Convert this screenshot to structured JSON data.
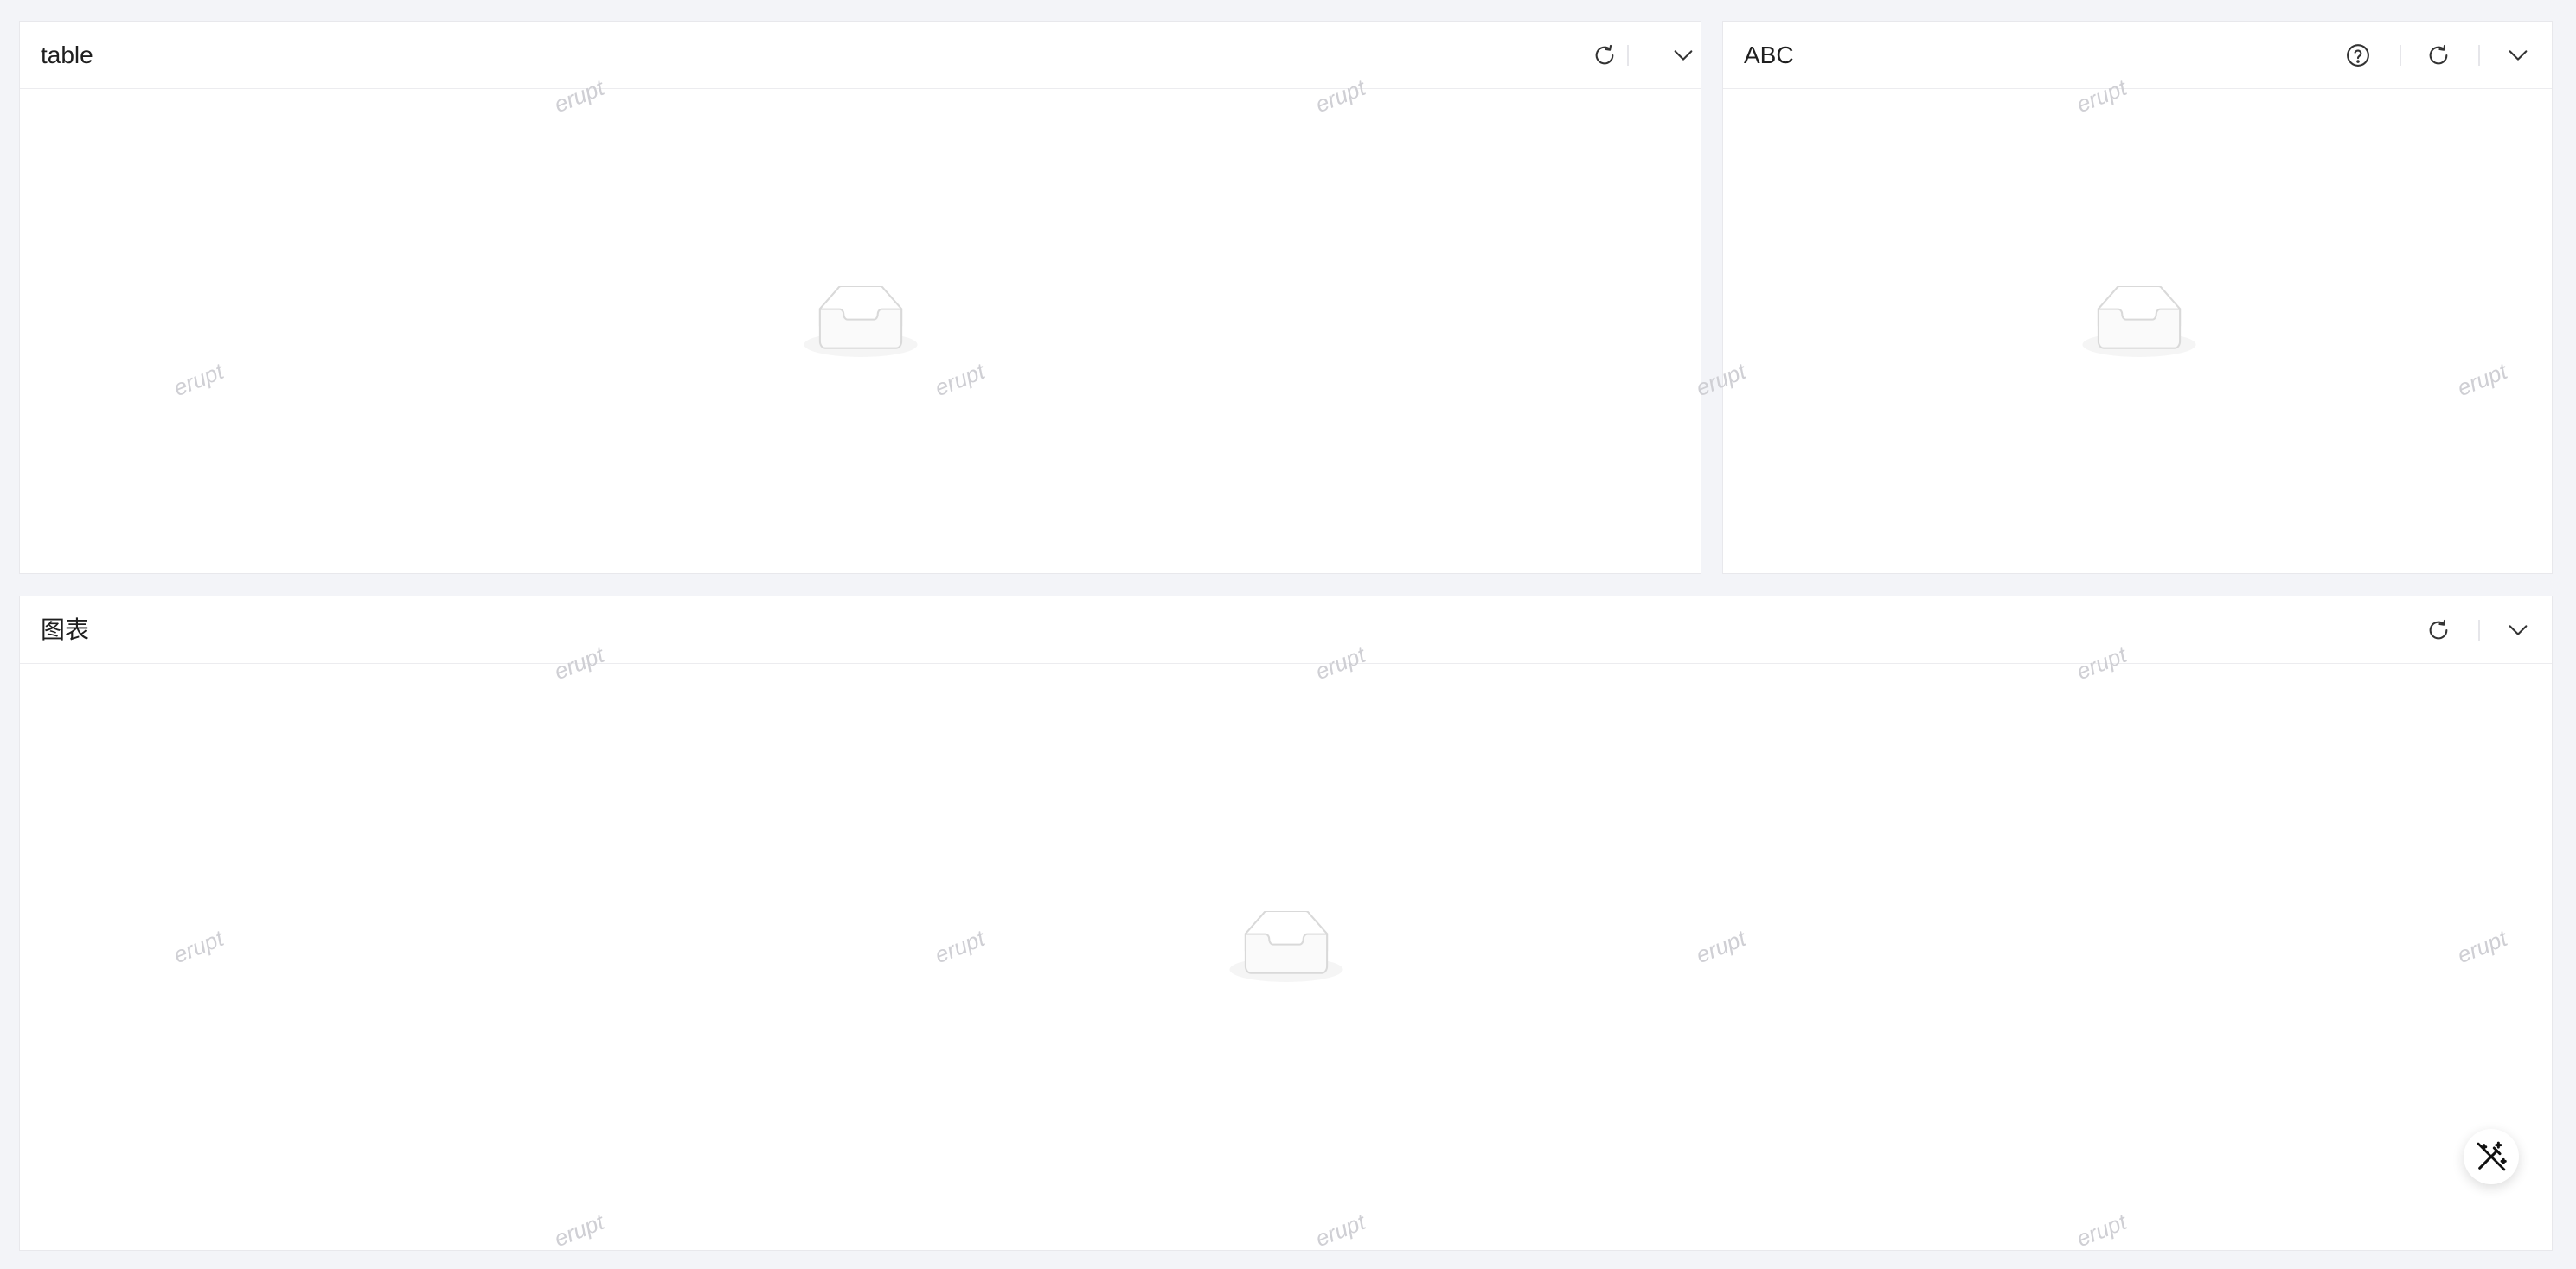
{
  "watermark_text": "erupt",
  "panels": [
    {
      "title": "table",
      "icons": [
        "reload-icon",
        "chevron-down-icon"
      ],
      "body": "empty-state"
    },
    {
      "title": "ABC",
      "icons": [
        "help-icon",
        "reload-icon",
        "chevron-down-icon"
      ],
      "body": "empty-state"
    },
    {
      "title": "图表",
      "icons": [
        "reload-icon",
        "chevron-down-icon"
      ],
      "body": "empty-state"
    }
  ],
  "fab": {
    "icon": "magic-wand-icon"
  },
  "colors": {
    "page_background": "#f3f4f8",
    "card_background": "#ffffff",
    "watermark": "#cfcfd4",
    "icon": "#333333"
  }
}
